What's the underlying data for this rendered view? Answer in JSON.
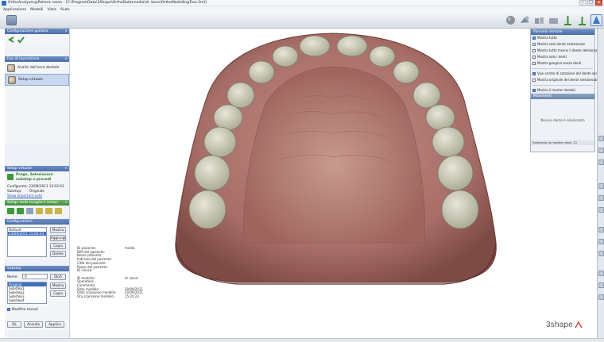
{
  "window": {
    "title": "OrthoAnalyzer@Patient name - [C:\\ProgramData\\3Shape\\OrthoData\\media\\dr. bonc\\OrthoModellingTree.3ml]",
    "controls": [
      "–",
      "□",
      "×"
    ]
  },
  "menu": [
    "Applicazione",
    "Modelli",
    "Vista",
    "Aiuto"
  ],
  "toolbar": {
    "right_buttons": [
      "sphere-icon",
      "compare-icon",
      "models-icon",
      "occlusion-icon",
      "tooth-movement-icon",
      "arch-icon"
    ]
  },
  "sidebar": {
    "wizard": {
      "title": "Configurazione guidata",
      "close": "×"
    },
    "steps_panel": {
      "title": "Fasi di lavorazione",
      "close": "×",
      "steps": [
        {
          "label": "Analisi dell'arco dentale",
          "selected": false
        },
        {
          "label": "Setup virtuale",
          "selected": true
        }
      ]
    },
    "setup_panel": {
      "title": "Setup virtuale",
      "close": "×",
      "prompt": "Prego, Selezionare substep o procedi",
      "configured_label": "Configurato:",
      "configured_value": "23/09/2011 15:02:43",
      "substep_label": "Substep:",
      "substep_value": "Originale",
      "link": "Show important note"
    },
    "tools_panel": {
      "title": "Setup: tools (sceglie il setup)",
      "close": "×"
    },
    "config_panel": {
      "title": "Configurazioni",
      "items": [
        "Default",
        "23/09/2011 15:02:43"
      ],
      "selected_index": 1,
      "buttons": [
        "Mostra",
        "Aggiungi",
        "Copia",
        "Delete"
      ]
    },
    "substep_panel": {
      "title": "Substep",
      "name_label": "Nome:",
      "name_value": "0",
      "rename_button": "Ok/A",
      "items": [
        "Original",
        "Substep1",
        "Substep2",
        "Substep3",
        "Substep4"
      ],
      "selected_index": 0,
      "buttons": [
        "Mostra",
        "Copia"
      ],
      "modify_label": "Modifica tessuti",
      "modify_checked": true
    },
    "footer_buttons": [
      "Ok",
      "Annulla",
      "Applica"
    ]
  },
  "viewport": {
    "patient_info": [
      {
        "k": "ID paziente:",
        "v": "media"
      },
      {
        "k": "DIM del paziente:",
        "v": ""
      },
      {
        "k": "Nome paziente:",
        "v": ""
      },
      {
        "k": "Indirizzo del paziente:",
        "v": ""
      },
      {
        "k": "Città del paziente:",
        "v": ""
      },
      {
        "k": "Paese del paziente:",
        "v": ""
      },
      {
        "k": "ID clinica:",
        "v": ""
      },
      {
        "k": "",
        "v": ""
      },
      {
        "k": "ID modello:",
        "v": "dr. bonci"
      },
      {
        "k": "Operatore:",
        "v": ""
      },
      {
        "k": "Commento:",
        "v": ""
      },
      {
        "k": "Data modello:",
        "v": "20/09/2011"
      },
      {
        "k": "Data scansione modello:",
        "v": "20/09/2011"
      },
      {
        "k": "Ora scansione modello:",
        "v": "15:20:23"
      }
    ],
    "brand": "3shape",
    "colors": {
      "gum": "#a86e68",
      "tooth": "#c9c8b6",
      "tooth_edge": "#7d7c6a"
    }
  },
  "right_panel": {
    "title": "Pannello dentale",
    "options": [
      {
        "label": "Mostra tutto",
        "checked": true
      },
      {
        "label": "Mostra solo dente selezionato",
        "checked": false
      },
      {
        "label": "Mostra tutto tranne il dente selezionato",
        "checked": false
      },
      {
        "label": "Mostra solo i denti",
        "checked": false
      },
      {
        "label": "Mostra gengiva senza denti",
        "checked": false
      }
    ],
    "options2": [
      {
        "label": "Vuoi centro di rotazione del dente sele...",
        "checked": true
      },
      {
        "label": "Mostra originale del dente selezionato",
        "checked": false
      }
    ],
    "options3": [
      {
        "label": "Mostra il marker dentali",
        "checked": true
      }
    ],
    "movement_title": "Movimenti",
    "movement_empty": "Nessun dente è selezionato",
    "footer": "Seleziona un marker dent. 11"
  }
}
